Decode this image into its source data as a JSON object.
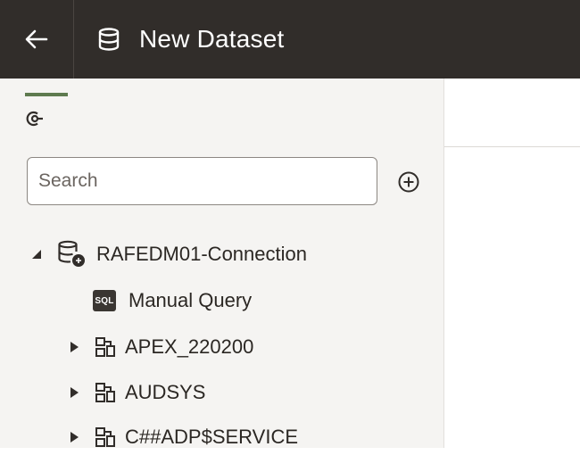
{
  "header": {
    "title": "New Dataset",
    "back_icon": "arrow-left-icon",
    "title_icon": "database-icon",
    "background": "#312d2a"
  },
  "sidebar": {
    "active_tab_icon": "connection-icon",
    "tab_indicator_color": "#5e7a4f",
    "search": {
      "placeholder": "Search",
      "value": ""
    },
    "add_icon": "plus-circle-icon",
    "tree": [
      {
        "label": "RAFEDM01-Connection",
        "icon": "database-connection-icon",
        "expanded": true,
        "level": 0
      },
      {
        "label": "Manual Query",
        "icon": "sql-icon",
        "badge": "SQL",
        "level": 1
      },
      {
        "label": "APEX_220200",
        "icon": "schema-icon",
        "expanded": false,
        "level": 1
      },
      {
        "label": "AUDSYS",
        "icon": "schema-icon",
        "expanded": false,
        "level": 1
      },
      {
        "label": "C##ADP$SERVICE",
        "icon": "schema-icon",
        "expanded": false,
        "level": 1
      }
    ]
  }
}
